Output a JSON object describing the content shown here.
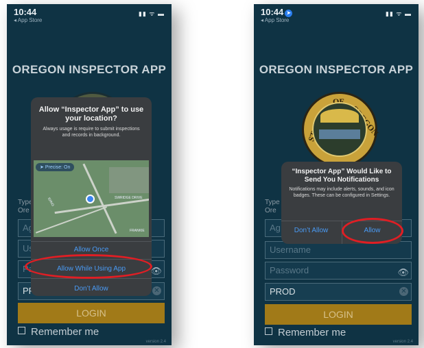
{
  "left_screen": {
    "status": {
      "time": "10:44",
      "back_label": "◂ App Store",
      "icons": "▮▮ ᯤ ▬"
    },
    "app_title": "OREGON INSPECTOR APP",
    "type_label": "Type\nOre",
    "fields": {
      "agency": "Ag",
      "username": "Us",
      "password": "Pa",
      "environment": "PRO"
    },
    "login_label": "LOGIN",
    "remember_label": "Remember me",
    "version": "version 2.4",
    "location_dialog": {
      "title": "Allow “Inspector App” to use your location?",
      "message": "Always usage is require to submit inspections and records in background.",
      "precise_label": "Precise: On",
      "map_street_1": "SWRIDGE DRIVE",
      "map_street_2": "IDING",
      "map_street_3": "FRANKIE",
      "buttons": [
        "Allow Once",
        "Allow While Using App",
        "Don’t Allow"
      ],
      "highlighted": "Allow While Using App"
    }
  },
  "right_screen": {
    "status": {
      "time": "10:44",
      "back_label": "◂ App Store",
      "icons": "▮▮ ᯤ ▬"
    },
    "app_title": "OREGON INSPECTOR APP",
    "seal_top": "OF",
    "seal_left": "STATE",
    "seal_right": "OREGON",
    "type_label": "Type\nOre",
    "fields": {
      "agency": "Ag",
      "username": "Username",
      "password": "Password",
      "environment": "PROD"
    },
    "login_label": "LOGIN",
    "remember_label": "Remember me",
    "version": "version 2.4",
    "notification_dialog": {
      "title": "“Inspector App” Would Like to Send You Notifications",
      "message": "Notifications may include alerts, sounds, and icon badges. These can be configured in Settings.",
      "dont_allow": "Don’t Allow",
      "allow": "Allow",
      "highlighted": "Allow"
    }
  },
  "colors": {
    "background": "#0f3344",
    "login_button": "#a17a18",
    "dialog": "#3a3d40",
    "ios_blue": "#4a9bf5",
    "annotation_red": "#e01e24"
  }
}
